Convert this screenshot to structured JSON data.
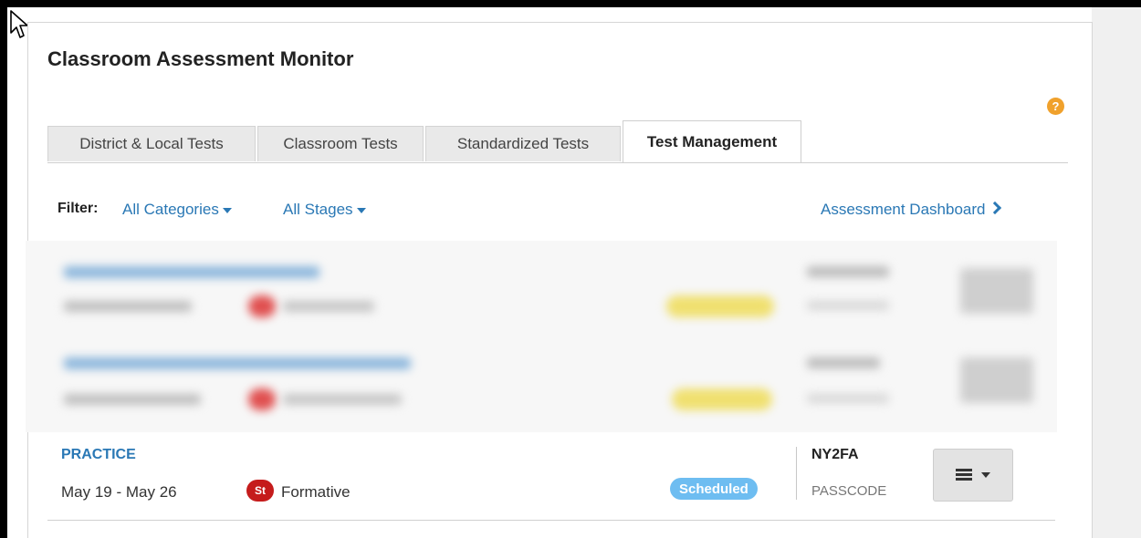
{
  "page": {
    "title": "Classroom Assessment Monitor",
    "help_icon": "?"
  },
  "tabs": [
    {
      "label": "District & Local Tests",
      "active": false
    },
    {
      "label": "Classroom Tests",
      "active": false
    },
    {
      "label": "Standardized Tests",
      "active": false
    },
    {
      "label": "Test Management",
      "active": true
    }
  ],
  "filter": {
    "label": "Filter:",
    "categories": "All Categories",
    "stages": "All Stages"
  },
  "dashboard_link": "Assessment Dashboard",
  "row": {
    "name": "PRACTICE",
    "dates": "May 19 - May 26",
    "type_badge": "St",
    "type_label": "Formative",
    "status": "Scheduled",
    "passcode": "NY2FA",
    "passcode_label": "PASSCODE"
  },
  "icons": {
    "help": "help-icon",
    "caret": "caret-down-icon",
    "chevron": "chevron-right-icon",
    "menu": "hamburger-icon"
  },
  "colors": {
    "link_blue": "#2a78b5",
    "status_blue": "#6ebdf1",
    "badge_red": "#c51c1c",
    "help_orange": "#f0a12c"
  }
}
